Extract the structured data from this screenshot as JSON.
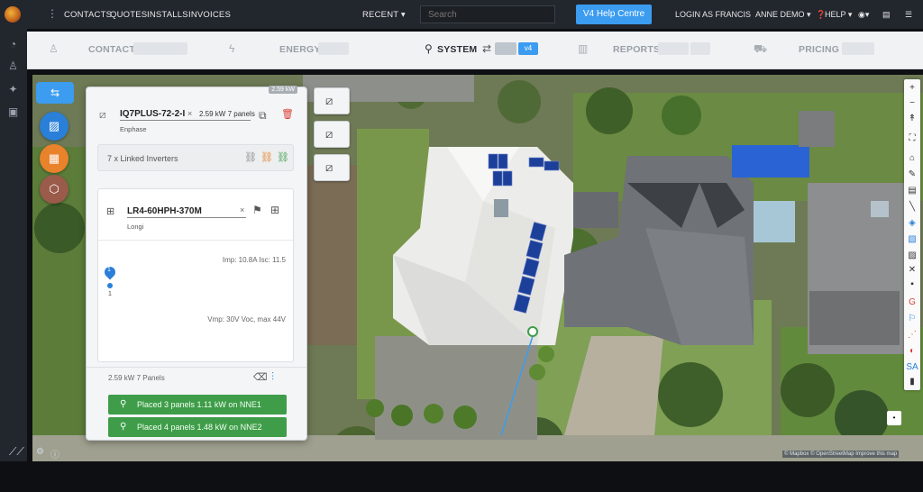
{
  "topnav": {
    "links": [
      "CONTACTS",
      "QUOTES",
      "INSTALLS",
      "INVOICES"
    ],
    "recent": "RECENT ▾",
    "search_placeholder": "Search",
    "help_centre": "V4 Help Centre",
    "login_as": "LOGIN AS FRANCIS",
    "user": "ANNE DEMO ▾",
    "help": "HELP ▾"
  },
  "subnav": {
    "tabs": [
      "CONTACT",
      "ENERGY",
      "SYSTEM",
      "REPORTS",
      "PRICING"
    ],
    "active": "SYSTEM",
    "system_badge": "v4"
  },
  "panel": {
    "inverter_name": "IQ7PLUS-72-2-I",
    "inverter_brand": "Enphase",
    "system_summary": "2.59 kW 7 panels",
    "linked_inverters": "7 x Linked Inverters",
    "module_name": "LR4-60HPH-370M",
    "module_brand": "Longi",
    "imp_isc": "Imp: 10.8A Isc: 11.5",
    "vmp_voc": "Vmp: 30V Voc, max 44V",
    "string_index": "1",
    "string_marker": "1",
    "footer_summary": "2.59 kW 7 Panels",
    "placed": [
      "Placed 3 panels 1.11 kW on NNE1",
      "Placed 4 panels 1.48 kW on NNE2"
    ],
    "corner_label": "2.59 kW"
  },
  "map": {
    "attribution": "© Mapbox © OpenStreetMap Improve this map"
  },
  "colors": {
    "topbar": "#22262d",
    "accent": "#3b9cf0",
    "place_green": "#3f9d4a",
    "panel_bg": "#f4f5f6"
  }
}
